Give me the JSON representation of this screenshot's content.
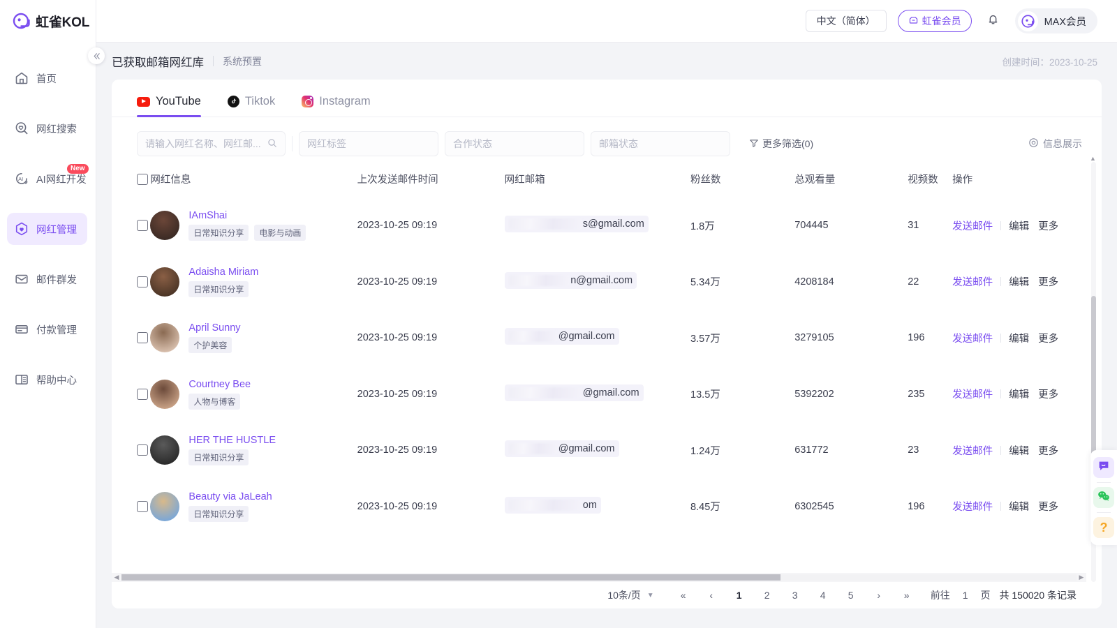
{
  "brand": {
    "name": "虹雀KOL",
    "logo_icon": "hongque-logo-icon",
    "accent": "#7a4df0"
  },
  "sidebar": {
    "collapse_icon": "chevron-double-left-icon",
    "items": [
      {
        "label": "首页",
        "icon": "home-icon",
        "active": false
      },
      {
        "label": "网红搜索",
        "icon": "search-heart-icon",
        "active": false
      },
      {
        "label": "AI网红开发",
        "icon": "ai-icon",
        "active": false,
        "badge": "New"
      },
      {
        "label": "网红管理",
        "icon": "hexagon-heart-icon",
        "active": true
      },
      {
        "label": "邮件群发",
        "icon": "mail-icon",
        "active": false
      },
      {
        "label": "付款管理",
        "icon": "card-icon",
        "active": false
      },
      {
        "label": "帮助中心",
        "icon": "book-icon",
        "active": false
      }
    ]
  },
  "topbar": {
    "language": "中文（简体）",
    "vip_label": "虹雀会员",
    "vip_icon": "crown-icon",
    "bell_icon": "bell-icon",
    "user_name": "MAX会员",
    "avatar_icon": "user-avatar-icon"
  },
  "page_header": {
    "title": "已获取邮箱网红库",
    "subtitle": "系统预置",
    "created_label": "创建时间：",
    "created_value": "2023-10-25"
  },
  "tabs": [
    {
      "label": "YouTube",
      "icon": "youtube-icon",
      "active": true
    },
    {
      "label": "Tiktok",
      "icon": "tiktok-icon",
      "active": false
    },
    {
      "label": "Instagram",
      "icon": "instagram-icon",
      "active": false
    }
  ],
  "filters": {
    "search_placeholder": "请输入网红名称、网红邮...",
    "search_value": "",
    "search_icon": "search-icon",
    "tag_placeholder": "网红标签",
    "coop_placeholder": "合作状态",
    "mail_placeholder": "邮箱状态",
    "more_filter_label": "更多筛选(0)",
    "more_filter_icon": "filter-icon",
    "info_show_label": "信息展示",
    "info_show_icon": "eye-icon"
  },
  "table": {
    "columns": [
      "网红信息",
      "上次发送邮件时间",
      "网红邮箱",
      "粉丝数",
      "总观看量",
      "视频数",
      "操作"
    ],
    "actions": {
      "send": "发送邮件",
      "edit": "编辑",
      "more": "更多"
    },
    "rows": [
      {
        "name": "IAmShai",
        "tags": [
          "日常知识分享",
          "电影与动画"
        ],
        "last_sent": "2023-10-25 09:19",
        "email_redacted": "●●●●●●●●●●●●",
        "email_suffix": "s@gmail.com",
        "fans": "1.8万",
        "views": "704445",
        "videos": "31"
      },
      {
        "name": "Adaisha Miriam",
        "tags": [
          "日常知识分享"
        ],
        "last_sent": "2023-10-25 09:19",
        "email_redacted": "●●●●●●●●●●",
        "email_suffix": "n@gmail.com",
        "fans": "5.34万",
        "views": "4208184",
        "videos": "22"
      },
      {
        "name": "April Sunny",
        "tags": [
          "个护美容"
        ],
        "last_sent": "2023-10-25 09:19",
        "email_redacted": "●●●●●●●●",
        "email_suffix": "@gmail.com",
        "fans": "3.57万",
        "views": "3279105",
        "videos": "196"
      },
      {
        "name": "Courtney Bee",
        "tags": [
          "人物与博客"
        ],
        "last_sent": "2023-10-25 09:19",
        "email_redacted": "●●●●●●●●●●●●",
        "email_suffix": "@gmail.com",
        "fans": "13.5万",
        "views": "5392202",
        "videos": "235"
      },
      {
        "name": "HER THE HUSTLE",
        "tags": [
          "日常知识分享"
        ],
        "last_sent": "2023-10-25 09:19",
        "email_redacted": "●●●●●●●●",
        "email_suffix": "@gmail.com",
        "fans": "1.24万",
        "views": "631772",
        "videos": "23"
      },
      {
        "name": "Beauty via JaLeah",
        "tags": [
          "日常知识分享"
        ],
        "last_sent": "2023-10-25 09:19",
        "email_redacted": "●●●●●●●●●●●●",
        "email_suffix": "om",
        "fans": "8.45万",
        "views": "6302545",
        "videos": "196"
      }
    ]
  },
  "pagination": {
    "page_size": "10条/页",
    "first_icon": "«",
    "prev_icon": "‹",
    "pages": [
      "1",
      "2",
      "3",
      "4",
      "5"
    ],
    "current_page": "1",
    "next_icon": "›",
    "last_icon": "»",
    "goto_label": "前往",
    "goto_value": "1",
    "page_unit": "页",
    "total_text": "共 150020 条记录"
  },
  "float_widgets": [
    {
      "icon": "chat-bubble-icon",
      "name": "online-service"
    },
    {
      "icon": "wechat-icon",
      "name": "wechat-contact"
    },
    {
      "icon": "question-mark-icon",
      "name": "help"
    }
  ]
}
